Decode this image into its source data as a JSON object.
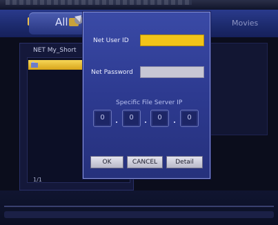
{
  "tabs": {
    "all_label": "All",
    "movies_label": "Movies"
  },
  "browser": {
    "path_label": "NET   My_Short",
    "page_count": "1/1"
  },
  "dialog": {
    "user_id_label": "Net User ID",
    "user_id_value": "",
    "password_label": "Net Password",
    "password_value": "",
    "ip_title": "Specific File Server IP",
    "ip_octets": [
      "0",
      "0",
      "0",
      "0"
    ],
    "buttons": {
      "ok": "OK",
      "cancel": "CANCEL",
      "detail": "Detail"
    }
  },
  "colors": {
    "accent_yellow": "#f2c418",
    "dialog_blue": "#2d3a90"
  }
}
